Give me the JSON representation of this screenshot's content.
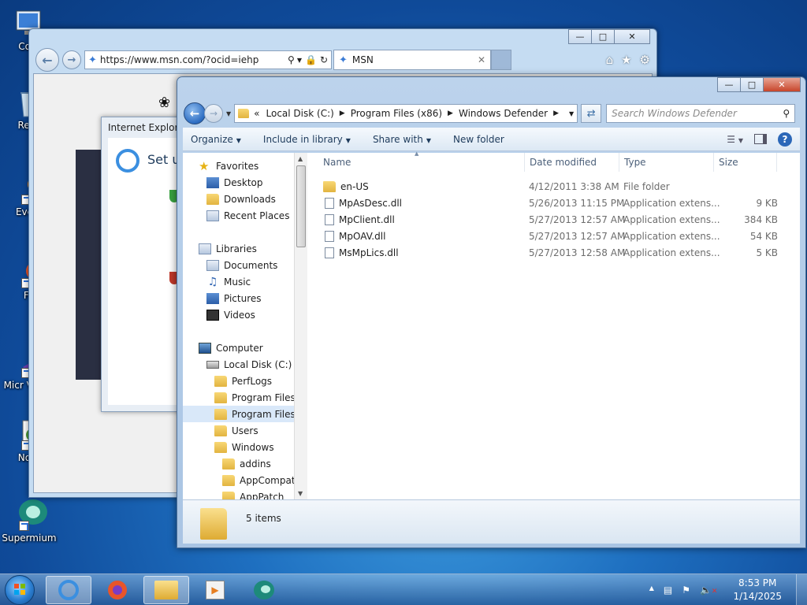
{
  "desktop": {
    "icons": [
      {
        "label": "Com",
        "icon": "computer-icon"
      },
      {
        "label": "Recy",
        "icon": "recycle-bin-icon"
      },
      {
        "label": "Every",
        "icon": "everything-icon"
      },
      {
        "label": "Fir",
        "icon": "firefox-icon"
      },
      {
        "label": "Micr Visual",
        "icon": "visual-studio-icon"
      },
      {
        "label": "Note",
        "icon": "notepad-icon"
      },
      {
        "label": "Supermium",
        "icon": "supermium-icon"
      }
    ]
  },
  "ie": {
    "url": "https://www.msn.com/?ocid=iehp",
    "tab_title": "MSN",
    "dialog_title": "Internet Explorer",
    "dialog_heading": "Set up"
  },
  "explorer": {
    "breadcrumb": [
      "Local Disk (C:)",
      "Program Files (x86)",
      "Windows Defender"
    ],
    "search_placeholder": "Search Windows Defender",
    "commands": {
      "organize": "Organize",
      "include": "Include in library",
      "share": "Share with",
      "new_folder": "New folder"
    },
    "nav": {
      "favorites": "Favorites",
      "desktop": "Desktop",
      "downloads": "Downloads",
      "recent": "Recent Places",
      "libraries": "Libraries",
      "documents": "Documents",
      "music": "Music",
      "pictures": "Pictures",
      "videos": "Videos",
      "computer": "Computer",
      "local_disk": "Local Disk (C:)",
      "perflogs": "PerfLogs",
      "program_files": "Program Files",
      "program_files_x86": "Program Files (",
      "users": "Users",
      "windows": "Windows",
      "addins": "addins",
      "appcompat": "AppCompat",
      "apppatch": "AppPatch"
    },
    "columns": {
      "name": "Name",
      "date": "Date modified",
      "type": "Type",
      "size": "Size"
    },
    "files": [
      {
        "name": "en-US",
        "date": "4/12/2011 3:38 AM",
        "type": "File folder",
        "size": ""
      },
      {
        "name": "MpAsDesc.dll",
        "date": "5/26/2013 11:15 PM",
        "type": "Application extens...",
        "size": "9 KB"
      },
      {
        "name": "MpClient.dll",
        "date": "5/27/2013 12:57 AM",
        "type": "Application extens...",
        "size": "384 KB"
      },
      {
        "name": "MpOAV.dll",
        "date": "5/27/2013 12:57 AM",
        "type": "Application extens...",
        "size": "54 KB"
      },
      {
        "name": "MsMpLics.dll",
        "date": "5/27/2013 12:58 AM",
        "type": "Application extens...",
        "size": "5 KB"
      }
    ],
    "item_count": "5 items"
  },
  "taskbar": {
    "time": "8:53 PM",
    "date": "1/14/2025"
  },
  "colors": {
    "accent": "#2b67b8",
    "folder": "#e2b440"
  }
}
